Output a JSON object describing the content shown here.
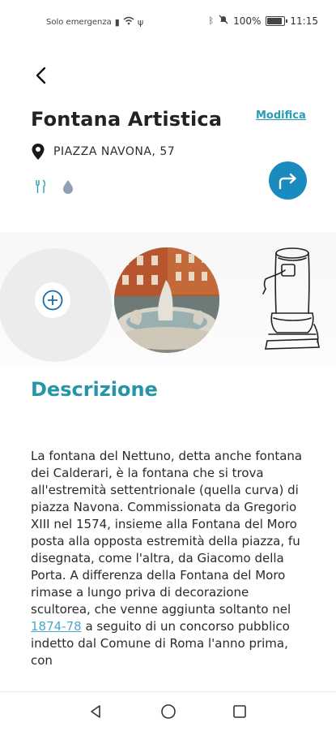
{
  "status_bar": {
    "carrier_text": "Solo emergenza",
    "battery": "100%",
    "time": "11:15"
  },
  "header": {
    "back_icon": "chevron-left-icon",
    "title": "Fontana Artistica",
    "edit_label": "Modifica",
    "address": "PIAZZA NAVONA, 57",
    "amenities": [
      "utensils-icon",
      "water-drop-icon"
    ],
    "navigate_icon": "directions-arrow-icon"
  },
  "gallery": {
    "add_photo_icon": "plus-circle-icon",
    "photos": [
      "photo-fontana-del-nettuno",
      "fountain-drawing"
    ]
  },
  "description": {
    "title": "Descrizione",
    "text_before_link": "La fontana del Nettuno, detta anche fontana dei Calderari, è la fontana che si trova all'estremità settentrionale (quella curva) di piazza Navona. Commissionata da Gregorio XIII nel 1574, insieme alla Fontana del Moro posta alla opposta estremità della piazza, fu disegnata, come l'altra, da Giacomo della Porta. A differenza della Fontana del Moro rimase a lungo priva di decorazione scultorea, che venne aggiunta soltanto nel ",
    "link_text": "1874-78",
    "text_after_link": " a seguito di un concorso pubblico indetto dal Comune di Roma l'anno prima, con"
  },
  "colors": {
    "accent": "#2596a8",
    "nav_button": "#1a8bbf",
    "link": "#4aa8d4"
  }
}
